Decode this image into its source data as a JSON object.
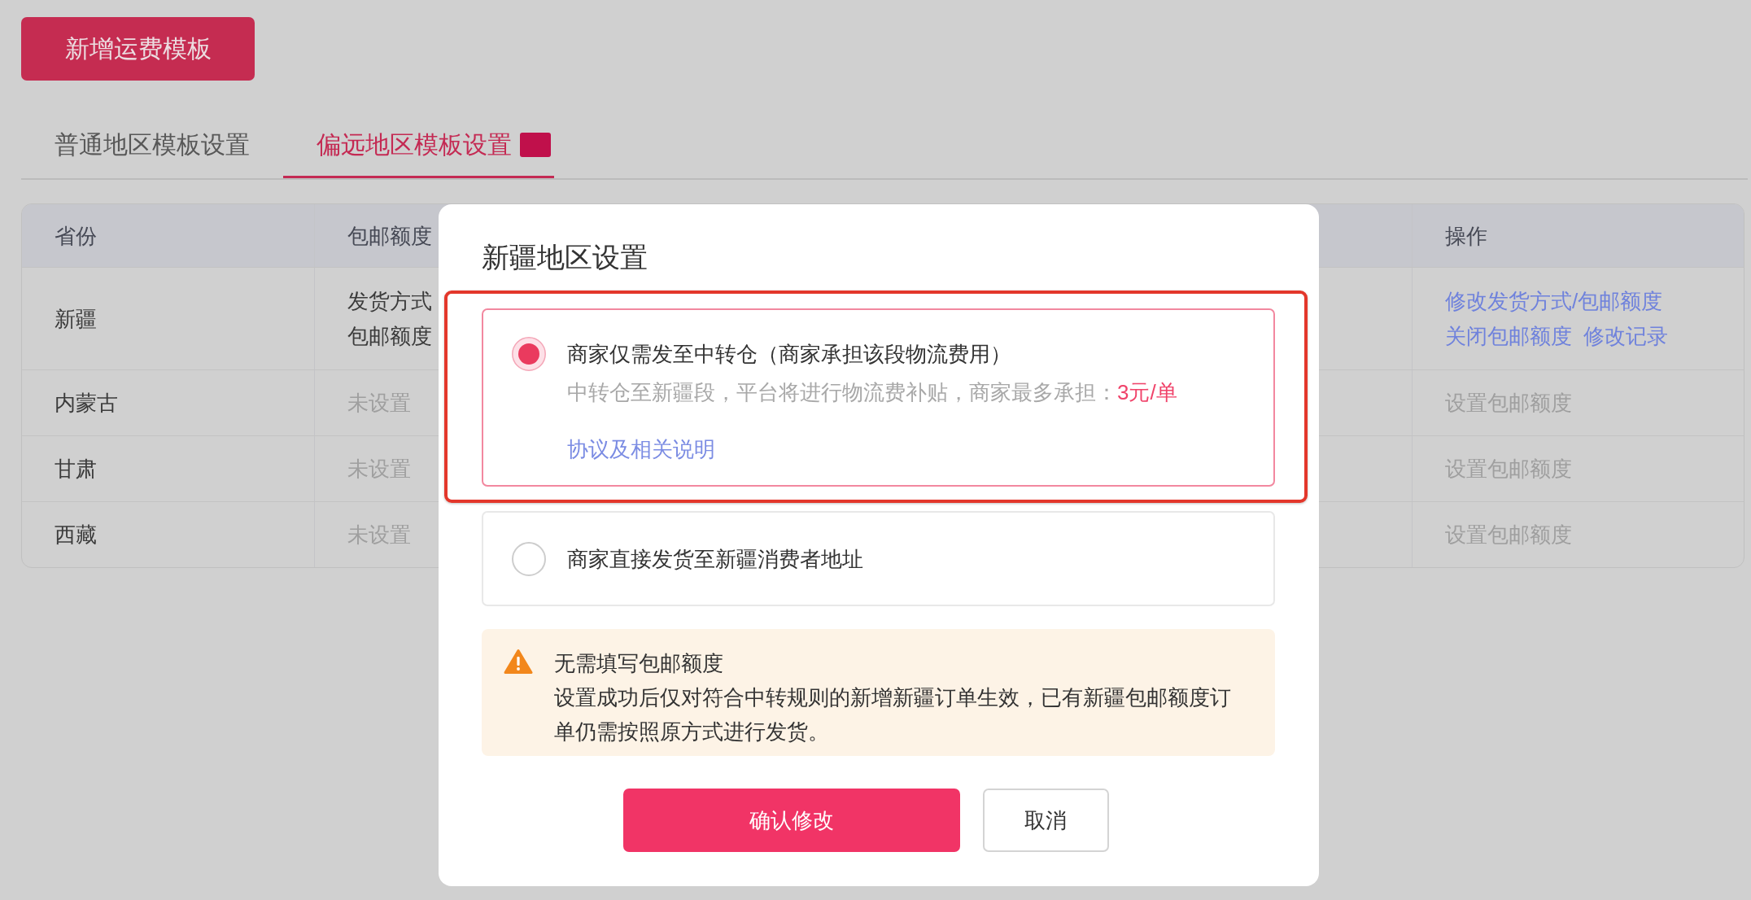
{
  "add_button": "新增运费模板",
  "tabs": [
    {
      "label": "普通地区模板设置",
      "selected": false,
      "badge": false
    },
    {
      "label": "偏远地区模板设置",
      "selected": true,
      "badge": true
    }
  ],
  "table": {
    "columns": [
      "省份",
      "包邮额度",
      "操作"
    ],
    "rows": [
      {
        "province": "新疆",
        "quota": {
          "set": true,
          "lines": [
            "发货方式",
            "包邮额度"
          ]
        },
        "actions": [
          {
            "label": "修改发货方式/包邮额度",
            "disabled": false
          },
          {
            "label": "关闭包邮额度",
            "disabled": false
          },
          {
            "label": "修改记录",
            "disabled": false
          }
        ]
      },
      {
        "province": "内蒙古",
        "quota": {
          "set": false,
          "lines": [
            "未设置"
          ]
        },
        "actions": [
          {
            "label": "设置包邮额度",
            "disabled": true
          }
        ]
      },
      {
        "province": "甘肃",
        "quota": {
          "set": false,
          "lines": [
            "未设置"
          ]
        },
        "actions": [
          {
            "label": "设置包邮额度",
            "disabled": true
          }
        ]
      },
      {
        "province": "西藏",
        "quota": {
          "set": false,
          "lines": [
            "未设置"
          ]
        },
        "actions": [
          {
            "label": "设置包邮额度",
            "disabled": true
          }
        ]
      }
    ]
  },
  "dialog": {
    "title": "新疆地区设置",
    "options": [
      {
        "label": "商家仅需发至中转仓（商家承担该段物流费用）",
        "selected": true,
        "highlighted": true,
        "description": "中转仓至新疆段，平台将进行物流费补贴，商家最多承担：",
        "fee": "3元/单",
        "link": "协议及相关说明"
      },
      {
        "label": "商家直接发货至新疆消费者地址",
        "selected": false,
        "highlighted": false
      }
    ],
    "notice": {
      "title": "无需填写包邮额度",
      "text": "设置成功后仅对符合中转规则的新增新疆订单生效，已有新疆包邮额度订单仍需按照原方式进行发货。"
    },
    "buttons": [
      {
        "label": "确认修改",
        "kind": "primary"
      },
      {
        "label": "取消",
        "kind": "secondary"
      }
    ]
  }
}
